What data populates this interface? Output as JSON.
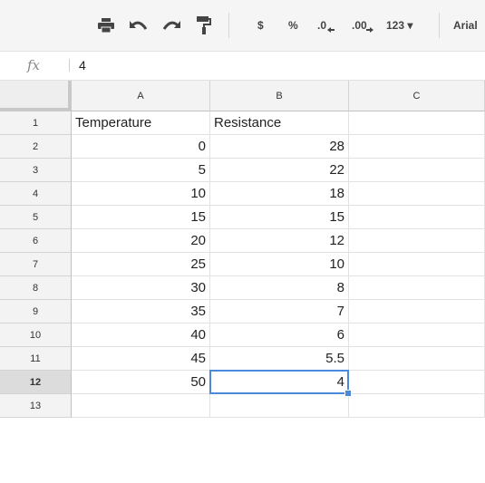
{
  "toolbar": {
    "currency_label": "$",
    "percent_label": "%",
    "decrease_decimal_label": ".0",
    "increase_decimal_label": ".00",
    "format_label": "123 ▾",
    "font_label": "Arial"
  },
  "formula_bar": {
    "fx_label": "fx",
    "value": "4"
  },
  "columns": [
    "A",
    "B",
    "C"
  ],
  "rows": [
    {
      "num": "1",
      "a": "Temperature",
      "b": "Resistance"
    },
    {
      "num": "2",
      "a": "0",
      "b": "28"
    },
    {
      "num": "3",
      "a": "5",
      "b": "22"
    },
    {
      "num": "4",
      "a": "10",
      "b": "18"
    },
    {
      "num": "5",
      "a": "15",
      "b": "15"
    },
    {
      "num": "6",
      "a": "20",
      "b": "12"
    },
    {
      "num": "7",
      "a": "25",
      "b": "10"
    },
    {
      "num": "8",
      "a": "30",
      "b": "8"
    },
    {
      "num": "9",
      "a": "35",
      "b": "7"
    },
    {
      "num": "10",
      "a": "40",
      "b": "6"
    },
    {
      "num": "11",
      "a": "45",
      "b": "5.5"
    },
    {
      "num": "12",
      "a": "50",
      "b": "4"
    },
    {
      "num": "13",
      "a": "",
      "b": ""
    }
  ],
  "selection": {
    "row": "12",
    "column": "B"
  },
  "colors": {
    "selection": "#4a89dc",
    "header_bg": "#f3f3f3",
    "toolbar_bg": "#f5f5f5"
  }
}
